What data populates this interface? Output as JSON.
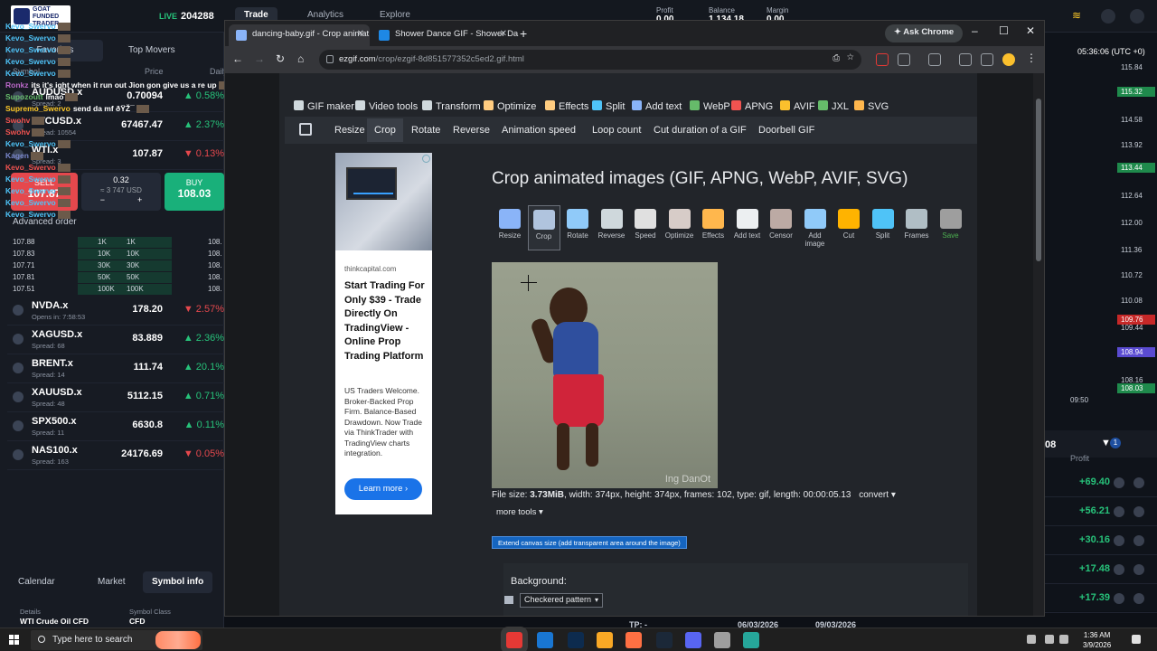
{
  "platform": {
    "logo_text": "GOAT FUNDED TRADER",
    "live_label": "LIVE",
    "account_id": "204288",
    "nav": [
      "Trade",
      "Analytics",
      "Explore"
    ],
    "stats": [
      {
        "label": "Profit",
        "value": "0.00"
      },
      {
        "label": "Balance",
        "value": "1,134.18"
      },
      {
        "label": "Margin",
        "value": "0.00"
      }
    ],
    "tabs": {
      "favorites": "Favorites",
      "top_movers": "Top Movers"
    },
    "columns": {
      "symbol": "Symbol",
      "price": "Price",
      "daily": "Daily"
    },
    "symbols": [
      {
        "name": "AUDUSD.x",
        "spread": "Spread: 2",
        "price": "0.70094",
        "change": "0.58%",
        "dir": "up"
      },
      {
        "name": "BTCUSD.x",
        "spread": "Spread: 10554",
        "price": "67467.47",
        "change": "2.37%",
        "dir": "up"
      },
      {
        "name": "WTI.x",
        "spread": "Spread: 3",
        "price": "107.87",
        "change": "0.13%",
        "dir": "down"
      },
      {
        "name": "NVDA.x",
        "spread": "Opens in: 7:58:53",
        "price": "178.20",
        "change": "2.57%",
        "dir": "down"
      },
      {
        "name": "XAGUSD.x",
        "spread": "Spread: 68",
        "price": "83.889",
        "change": "2.36%",
        "dir": "up"
      },
      {
        "name": "BRENT.x",
        "spread": "Spread: 14",
        "price": "111.74",
        "change": "20.1%",
        "dir": "up"
      },
      {
        "name": "XAUUSD.x",
        "spread": "Spread: 48",
        "price": "5112.15",
        "change": "0.71%",
        "dir": "up"
      },
      {
        "name": "SPX500.x",
        "spread": "Spread: 11",
        "price": "6630.8",
        "change": "0.11%",
        "dir": "up"
      },
      {
        "name": "NAS100.x",
        "spread": "Spread: 163",
        "price": "24176.69",
        "change": "0.05%",
        "dir": "down"
      }
    ],
    "trade": {
      "sell_label": "SELL",
      "sell_price": "107.87",
      "lot": "0.32",
      "lot_usd": "≈ 3 747 USD",
      "buy_label": "BUY",
      "buy_price": "108.03",
      "minus": "−",
      "plus": "+"
    },
    "advanced_order": "Advanced order",
    "depth": [
      {
        "bid": "107.88",
        "a": "1K",
        "b": "1K",
        "ask": "108."
      },
      {
        "bid": "107.83",
        "a": "10K",
        "b": "10K",
        "ask": "108."
      },
      {
        "bid": "107.71",
        "a": "30K",
        "b": "30K",
        "ask": "108."
      },
      {
        "bid": "107.81",
        "a": "50K",
        "b": "50K",
        "ask": "108."
      },
      {
        "bid": "107.51",
        "a": "100K",
        "b": "100K",
        "ask": "108."
      }
    ],
    "bottom_tabs": [
      "Calendar",
      "Market",
      "Symbol info"
    ],
    "details": {
      "label1": "Details",
      "value1": "WTI Crude Oil CFD",
      "label2": "Symbol Class",
      "value2": "CFD"
    },
    "time": "05:36:06 (UTC +0)",
    "axis": [
      "115.84",
      "114.58",
      "113.92",
      "112.64",
      "112.00",
      "111.36",
      "110.72",
      "110.08",
      "109.44",
      "108.16"
    ],
    "axis_tags": [
      {
        "value": "115.32",
        "color": "#1f8a4c"
      },
      {
        "value": "113.44",
        "color": "#1f8a4c"
      },
      {
        "value": "109.76",
        "color": "#c62828"
      },
      {
        "value": "108.94",
        "color": "#5a4bd1"
      },
      {
        "value": "108.03",
        "color": "#1f8a4c"
      }
    ],
    "chart_time": "09:50",
    "positions_header": "Profit",
    "positions_count": "1",
    "positions_partial": "08",
    "positions": [
      "+69.40",
      "+56.21",
      "+30.16",
      "+17.48",
      "+17.39"
    ],
    "chat": [
      {
        "user": "Kevo_Swervo",
        "msg": "",
        "color": "#4fc3f7"
      },
      {
        "user": "Kevo_Swervo",
        "msg": "",
        "color": "#4fc3f7"
      },
      {
        "user": "Kevo_Swervo",
        "msg": "",
        "color": "#4fc3f7"
      },
      {
        "user": "Kevo_Swervo",
        "msg": "",
        "color": "#4fc3f7"
      },
      {
        "user": "Kevo_Swervo",
        "msg": "",
        "color": "#4fc3f7"
      },
      {
        "user": "Ronkz",
        "msg": "its it's ight when it run out Jion gon give us a re up",
        "color": "#ba68c8"
      },
      {
        "user": "Supozoutt",
        "msg": "lmao",
        "color": "#66bb6a"
      },
      {
        "user": "Supremo_Swervo",
        "msg": "send da mf ðŸŽ¯",
        "color": "#ffca28"
      },
      {
        "user": "Swohv",
        "msg": "",
        "color": "#ef5350"
      },
      {
        "user": "Swohv",
        "msg": "",
        "color": "#ef5350"
      },
      {
        "user": "Kevo_Swervo",
        "msg": "",
        "color": "#4fc3f7"
      },
      {
        "user": "Kagen",
        "msg": "",
        "color": "#7986cb"
      },
      {
        "user": "Kevo_Swervo",
        "msg": "",
        "color": "#ef5350"
      },
      {
        "user": "Kevo_Swervo",
        "msg": "",
        "color": "#4fc3f7"
      },
      {
        "user": "Kevo_Swervo",
        "msg": "",
        "color": "#4fc3f7"
      },
      {
        "user": "Kevo_Swervo",
        "msg": "",
        "color": "#4fc3f7"
      },
      {
        "user": "Kevo_Swervo",
        "msg": "",
        "color": "#4fc3f7"
      }
    ]
  },
  "chrome": {
    "tabs": [
      {
        "title": "dancing-baby.gif - Crop animat",
        "active": true
      },
      {
        "title": "Shower Dance GIF - Shower Da",
        "active": false
      }
    ],
    "ask_chrome": "Ask Chrome",
    "url_host": "ezgif.com",
    "url_path": "/crop/ezgif-8d851577352c5ed2.gif.html"
  },
  "ezgif": {
    "main_nav": [
      "GIF maker",
      "Video tools",
      "Transform",
      "Optimize",
      "Effects",
      "Split",
      "Add text",
      "WebP",
      "APNG",
      "AVIF",
      "JXL",
      "SVG"
    ],
    "sub_nav": [
      "Resize",
      "Crop",
      "Rotate",
      "Reverse",
      "Animation speed",
      "Loop count",
      "Cut duration of a GIF",
      "Doorbell GIF"
    ],
    "sub_nav_selected": "Crop",
    "title": "Crop animated images (GIF, APNG, WebP, AVIF, SVG)",
    "tools": [
      {
        "label": "Resize",
        "color": "#8ab4f8"
      },
      {
        "label": "Crop",
        "color": "#b0c4de"
      },
      {
        "label": "Rotate",
        "color": "#90caf9"
      },
      {
        "label": "Reverse",
        "color": "#cfd8dc"
      },
      {
        "label": "Speed",
        "color": "#e0e0e0"
      },
      {
        "label": "Optimize",
        "color": "#d7ccc8"
      },
      {
        "label": "Effects",
        "color": "#ffb74d"
      },
      {
        "label": "Add text",
        "color": "#eceff1"
      },
      {
        "label": "Censor",
        "color": "#bcaaa4"
      },
      {
        "label": "Add image",
        "color": "#90caf9"
      },
      {
        "label": "Cut",
        "color": "#ffb300"
      },
      {
        "label": "Split",
        "color": "#4fc3f7"
      },
      {
        "label": "Frames",
        "color": "#b0bec5"
      },
      {
        "label": "Save",
        "color": "#9e9e9e"
      }
    ],
    "gif_watermark": "Ing DanOt",
    "file_info": {
      "prefix": "File size:",
      "size": "3.73MiB",
      "rest": ", width: 374px, height: 374px, frames: 102, type: gif, length: 00:00:05.13",
      "convert": "convert ▾"
    },
    "more_tools": "more tools ▾",
    "extend_button": "Extend canvas size (add transparent area around the image)",
    "background_label": "Background:",
    "background_value": "Checkered pattern",
    "ad": {
      "source": "thinkcapital.com",
      "headline": "Start Trading For Only $39 - Trade Directly On TradingView - Online Prop Trading Platform",
      "body": "US Traders Welcome. Broker-Backed Prop Firm. Balance-Based Drawdown. Now Trade via ThinkTrader with TradingView charts integration.",
      "cta": "Learn more ›"
    }
  },
  "taskbar": {
    "search_placeholder": "Type here to search",
    "time": "1:36 AM",
    "date": "3/9/2026",
    "apps": [
      {
        "name": "chrome",
        "color": "#e53935"
      },
      {
        "name": "v-app",
        "color": "#1976d2"
      },
      {
        "name": "photoshop",
        "color": "#0d2b4e"
      },
      {
        "name": "file-explorer",
        "color": "#f9a825"
      },
      {
        "name": "brave",
        "color": "#ff7043"
      },
      {
        "name": "steam",
        "color": "#1b2838"
      },
      {
        "name": "discord",
        "color": "#5865f2"
      },
      {
        "name": "app-8",
        "color": "#9e9e9e"
      },
      {
        "name": "app-9",
        "color": "#26a69a"
      }
    ]
  },
  "background_strip": {
    "tp": "TP: -",
    "d1": "06/03/2026",
    "d2": "09/03/2026"
  }
}
